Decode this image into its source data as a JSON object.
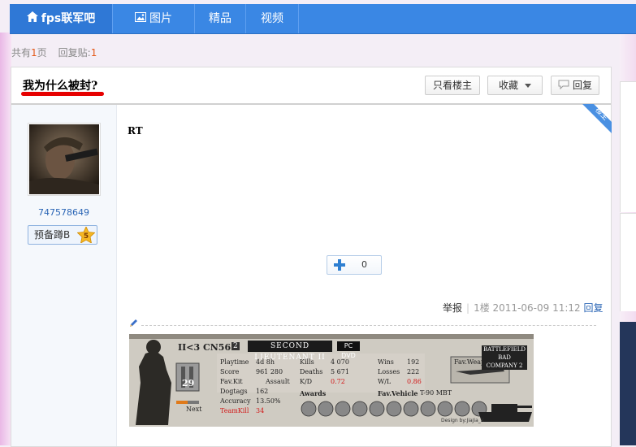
{
  "nav": {
    "home_label": "fps联军吧",
    "pic_label": "图片",
    "best_label": "精品",
    "video_label": "视频"
  },
  "page_info": {
    "total_prefix": "共有",
    "total_pages": "1",
    "total_suffix": "页",
    "reply_prefix": "回复贴:",
    "reply_count": "1"
  },
  "thread": {
    "title": "我为什么被封?",
    "only_author_label": "只看楼主",
    "favorite_label": "收藏",
    "reply_label": "回复"
  },
  "post": {
    "author_name": "747578649",
    "level_title": "预备蹲B",
    "level_num": "5",
    "badge_text": "楼主",
    "content": "RT",
    "like_count": "0",
    "report_label": "举报",
    "floor": "1楼",
    "datetime": "2011-06-09 11:12",
    "reply_link": "回复"
  },
  "signature": {
    "rank_title": "SECOND LIEUTENANT II",
    "player_name": "II<3 CN56",
    "rank_num": "2",
    "pc_label": "PC DVD",
    "level": "29",
    "next_label": "Next",
    "playtime_label": "Playtime",
    "playtime": "4d 8h",
    "score_label": "Score",
    "score": "961 280",
    "favkit_label": "Fav.Kit",
    "favkit": "Assault",
    "dogtags_label": "Dogtags",
    "dogtags": "162",
    "accuracy_label": "Accuracy",
    "accuracy": "13.50%",
    "teamkill_label": "TeamKill",
    "teamkill": "34",
    "kills_label": "Kills",
    "kills": "4 070",
    "deaths_label": "Deaths",
    "deaths": "5 671",
    "kd_label": "K/D",
    "kd": "0.72",
    "awards_label": "Awards",
    "wins_label": "Wins",
    "wins": "192",
    "losses_label": "Losses",
    "losses": "222",
    "wl_label": "W/L",
    "wl": "0.86",
    "favvehicle_label": "Fav.Vehicle",
    "favvehicle": "T-90 MBT",
    "favweapon_label": "Fav.Weapon",
    "logo_line1": "BATTLEFIELD",
    "logo_line2": "BAD COMPANY 2",
    "credit": "Design by:JiaJia_X"
  },
  "colors": {
    "nav_blue": "#3a87e4",
    "link_blue": "#2a65b5",
    "accent_orange": "#e45a1a",
    "underline_red": "#e60000"
  }
}
